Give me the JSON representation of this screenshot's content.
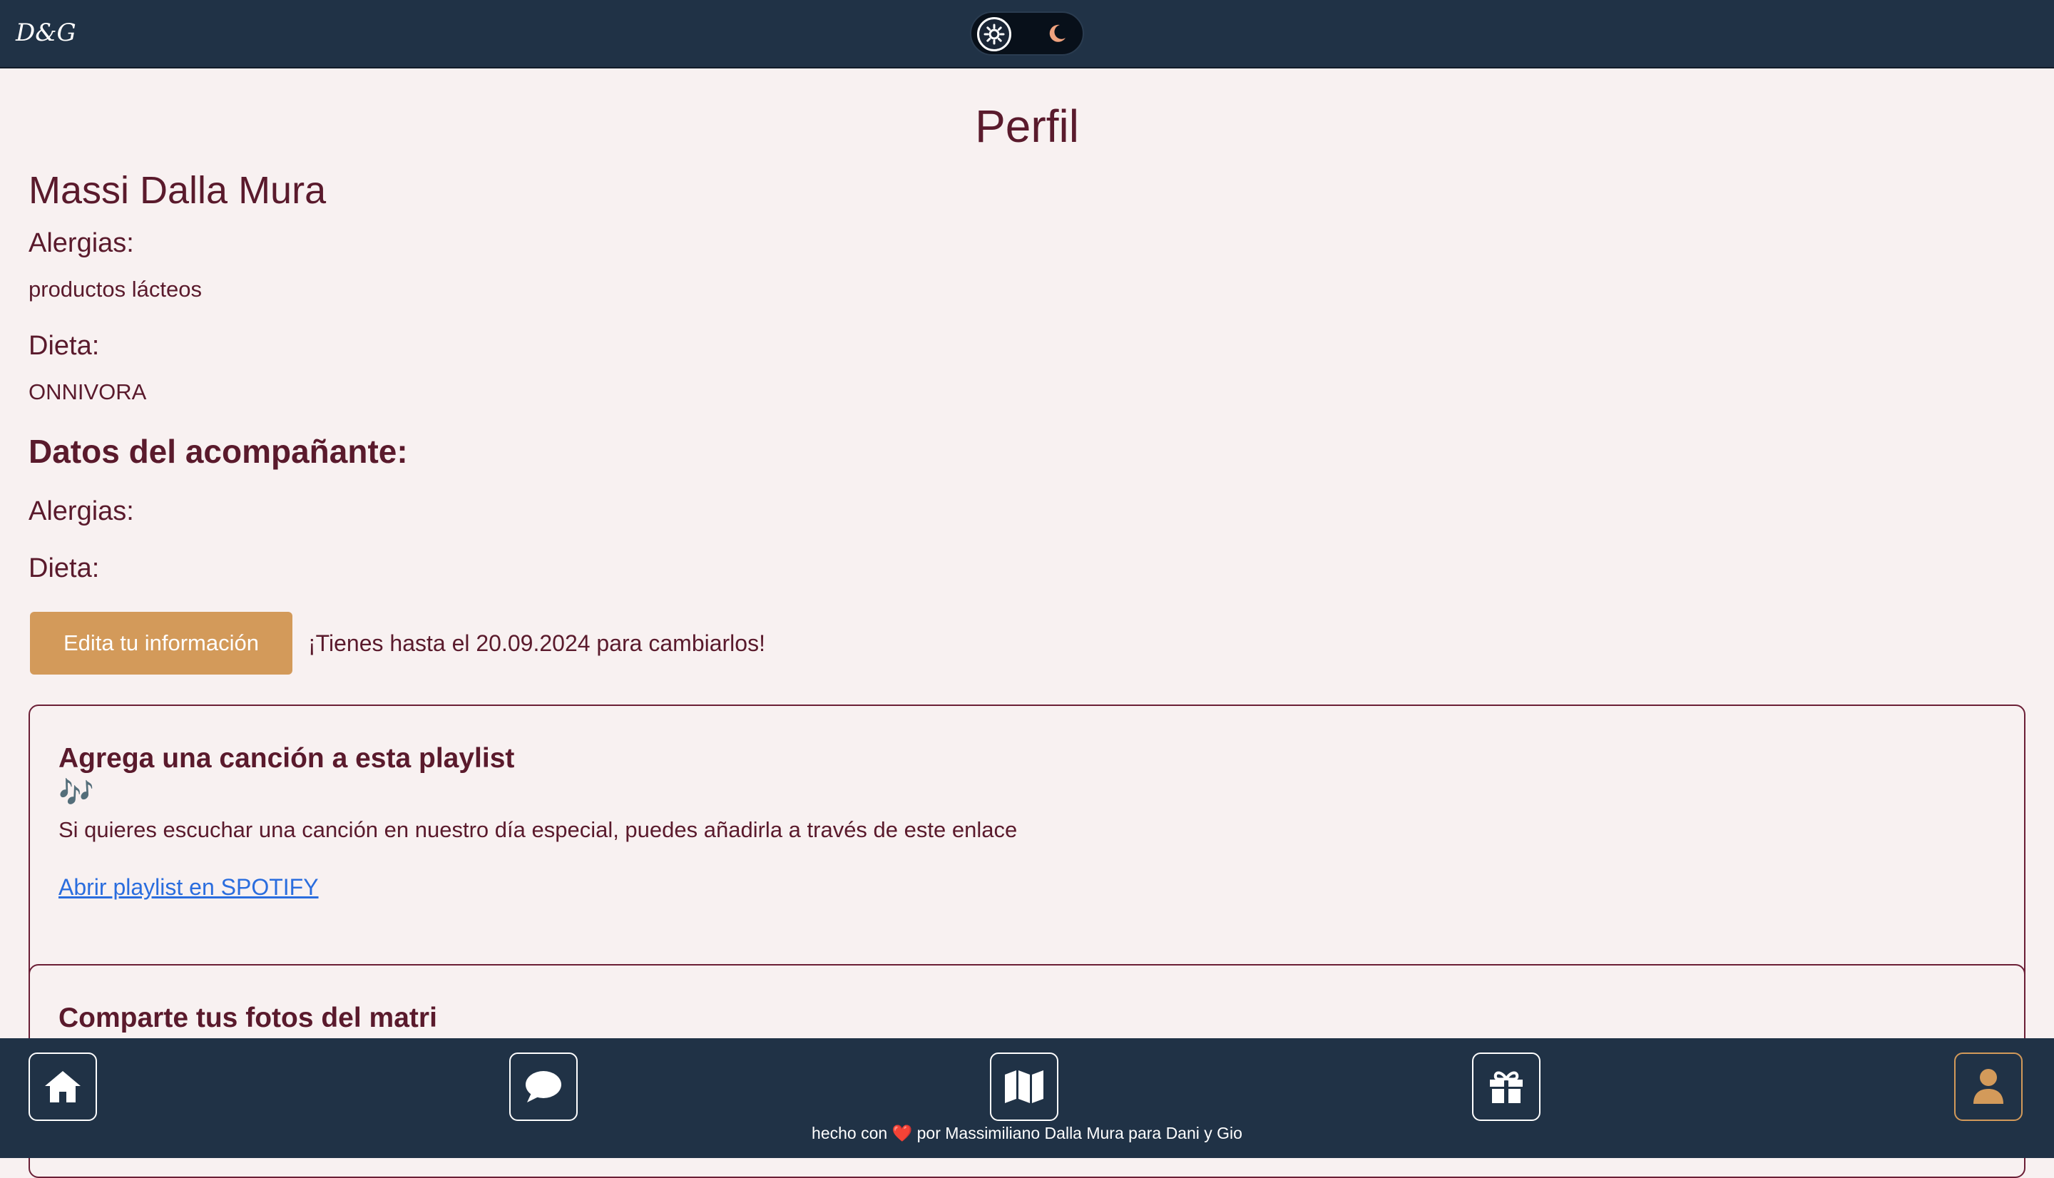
{
  "header": {
    "logo_text": "D&G",
    "theme_toggle": {
      "light_icon": "sun-icon",
      "dark_icon": "moon-icon",
      "moon_color": "#f0a27e"
    }
  },
  "profile": {
    "page_title": "Perfil",
    "name": "Massi Dalla Mura",
    "allergies_label": "Alergias:",
    "allergies_value": "productos lácteos",
    "diet_label": "Dieta:",
    "diet_value": "ONNIVORA",
    "companion_heading": "Datos del acompañante:",
    "companion_allergies_label": "Alergias:",
    "companion_diet_label": "Dieta:",
    "edit_button_label": "Edita tu información",
    "deadline_text": "¡Tienes hasta el 20.09.2024 para cambiarlos!"
  },
  "playlist_card": {
    "title": "Agrega una canción a esta playlist",
    "emoji": "🎶",
    "description": "Si quieres escuchar una canción en nuestro día especial, puedes añadirla a través de este enlace",
    "link_label": "Abrir playlist en SPOTIFY"
  },
  "photos_card": {
    "title": "Comparte tus fotos del matri"
  },
  "bottom_nav": {
    "items": [
      {
        "icon": "home-icon",
        "active": false
      },
      {
        "icon": "chat-icon",
        "active": false
      },
      {
        "icon": "map-icon",
        "active": false
      },
      {
        "icon": "gift-icon",
        "active": false
      },
      {
        "icon": "user-icon",
        "active": true
      }
    ],
    "footer_prefix": "hecho con",
    "footer_heart": "❤️",
    "footer_suffix": "por Massimiliano Dalla Mura para Dani y Gio"
  },
  "colors": {
    "header_bg": "#203246",
    "page_bg": "#f8f1f1",
    "text": "#5a1a2c",
    "accent": "#d39a5a",
    "link": "#2a6dde"
  }
}
